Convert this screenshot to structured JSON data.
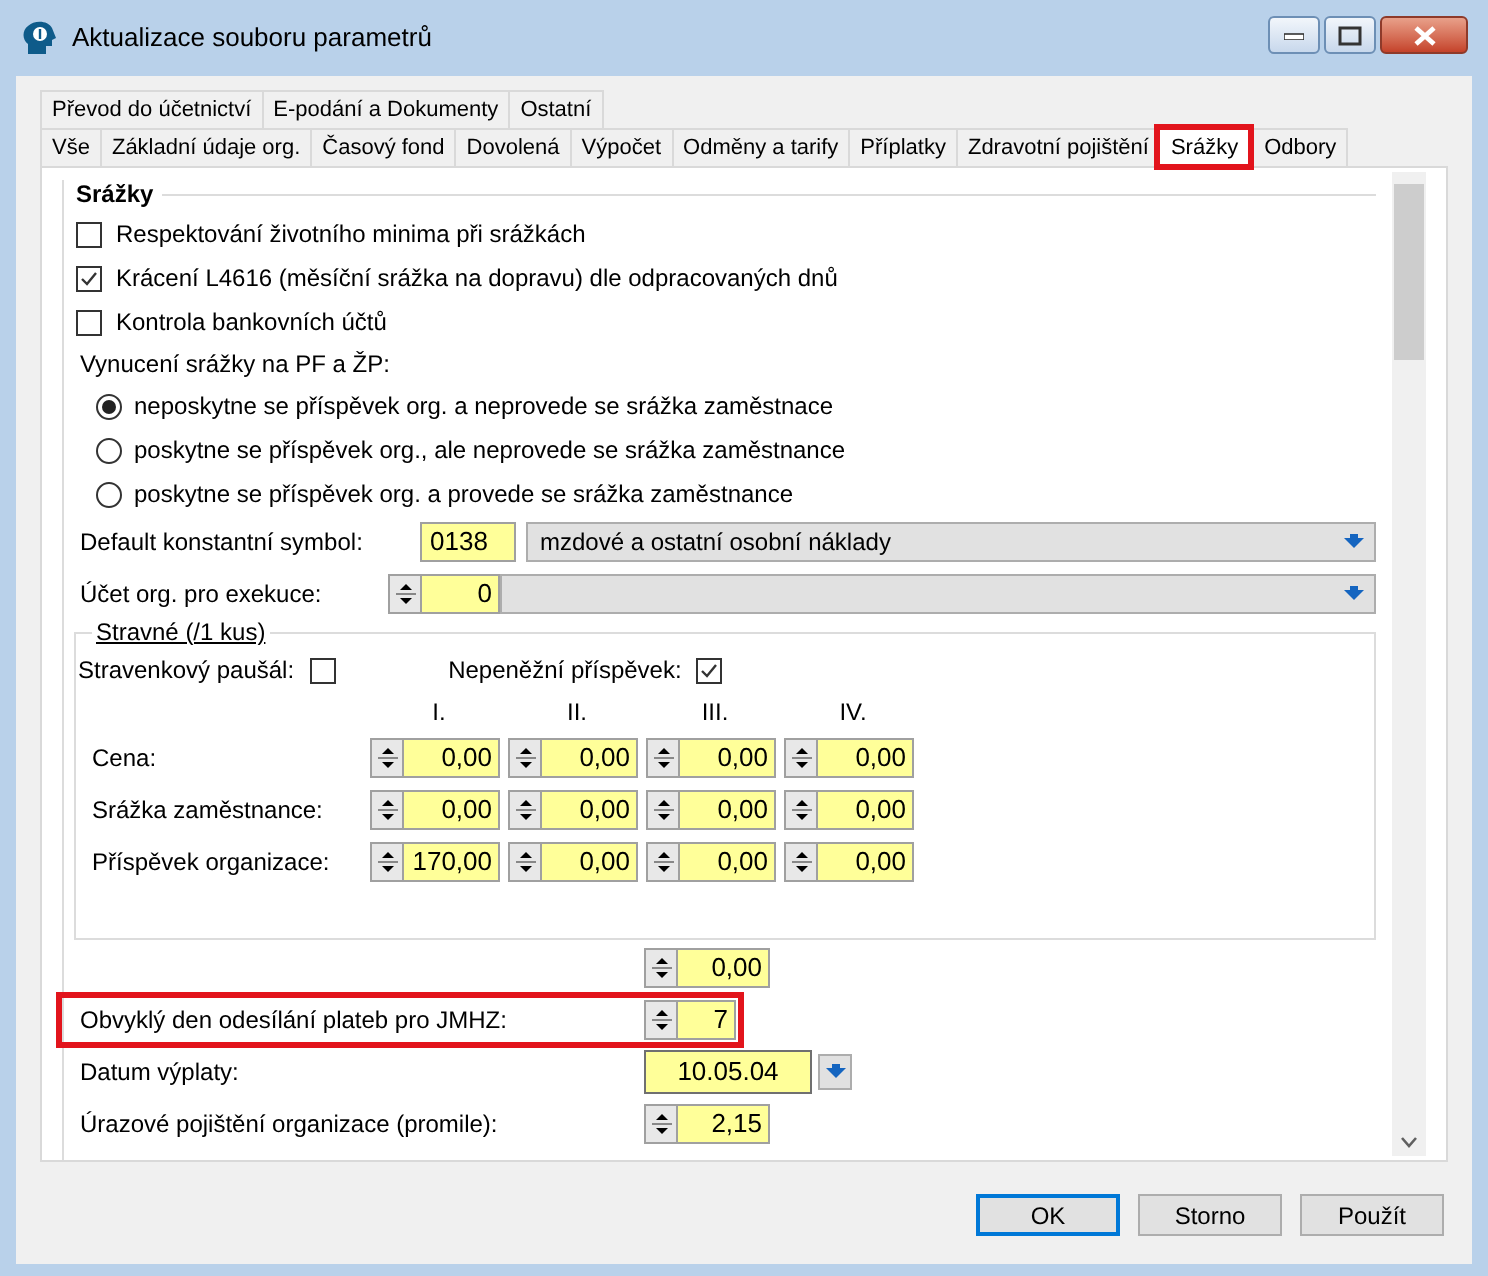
{
  "window": {
    "title": "Aktualizace souboru parametrů"
  },
  "tab_rows": [
    [
      {
        "label": "Převod do účetnictví",
        "selected": false,
        "highlighted": false
      },
      {
        "label": "E-podání a Dokumenty",
        "selected": false,
        "highlighted": false
      },
      {
        "label": "Ostatní",
        "selected": false,
        "highlighted": false
      }
    ],
    [
      {
        "label": "Vše",
        "selected": false,
        "highlighted": false
      },
      {
        "label": "Základní údaje org.",
        "selected": false,
        "highlighted": false
      },
      {
        "label": "Časový fond",
        "selected": false,
        "highlighted": false
      },
      {
        "label": "Dovolená",
        "selected": false,
        "highlighted": false
      },
      {
        "label": "Výpočet",
        "selected": false,
        "highlighted": false
      },
      {
        "label": "Odměny a tarify",
        "selected": false,
        "highlighted": false
      },
      {
        "label": "Příplatky",
        "selected": false,
        "highlighted": false
      },
      {
        "label": "Zdravotní pojištění",
        "selected": false,
        "highlighted": false
      },
      {
        "label": "Srážky",
        "selected": true,
        "highlighted": true
      },
      {
        "label": "Odbory",
        "selected": false,
        "highlighted": false
      }
    ]
  ],
  "section": {
    "title": "Srážky",
    "checkboxes": [
      {
        "label": "Respektování životního minima při srážkách",
        "checked": false
      },
      {
        "label": "Krácení L4616 (měsíční srážka na dopravu) dle odpracovaných dnů",
        "checked": true
      },
      {
        "label": "Kontrola bankovních účtů",
        "checked": false
      }
    ],
    "radio_group": {
      "label": "Vynucení srážky na PF a ŽP:",
      "options": [
        {
          "label": "neposkytne se příspěvek org. a neprovede se srážka zaměstnace",
          "selected": true
        },
        {
          "label": "poskytne se příspěvek org., ale neprovede se srážka zaměstnance",
          "selected": false
        },
        {
          "label": "poskytne se příspěvek org. a provede se srážka zaměstnance",
          "selected": false
        }
      ]
    },
    "constant_symbol": {
      "label": "Default konstantní symbol:",
      "value": "0138",
      "description": "mzdové a ostatní osobní náklady"
    },
    "account": {
      "label": "Účet org. pro exekuce:",
      "value": "0"
    },
    "meal": {
      "title": "Stravné (/1 kus)",
      "voucher_flat": {
        "label": "Stravenkový paušál:",
        "checked": false
      },
      "non_cash": {
        "label": "Nepeněžní příspěvek:",
        "checked": true
      },
      "columns": [
        "I.",
        "II.",
        "III.",
        "IV."
      ],
      "rows": [
        {
          "label": "Cena:",
          "values": [
            "0,00",
            "0,00",
            "0,00",
            "0,00"
          ]
        },
        {
          "label": "Srážka zaměstnance:",
          "values": [
            "0,00",
            "0,00",
            "0,00",
            "0,00"
          ]
        },
        {
          "label": "Příspěvek organizace:",
          "values": [
            "170,00",
            "0,00",
            "0,00",
            "0,00"
          ]
        }
      ]
    },
    "fields": [
      {
        "kind": "spinner",
        "value": "0,00",
        "highlighted": false
      },
      {
        "kind": "spinner",
        "label": "Obvyklý den odesílání plateb pro JMHZ:",
        "value": "7",
        "highlighted": true
      },
      {
        "kind": "date",
        "label": "Datum výplaty:",
        "value": "10.05.04",
        "highlighted": false
      },
      {
        "kind": "spinner",
        "label": "Úrazové pojištění organizace (promile):",
        "value": "2,15",
        "highlighted": false
      }
    ]
  },
  "buttons": [
    {
      "label": "OK",
      "default": true
    },
    {
      "label": "Storno",
      "default": false
    },
    {
      "label": "Použít",
      "default": false
    }
  ]
}
